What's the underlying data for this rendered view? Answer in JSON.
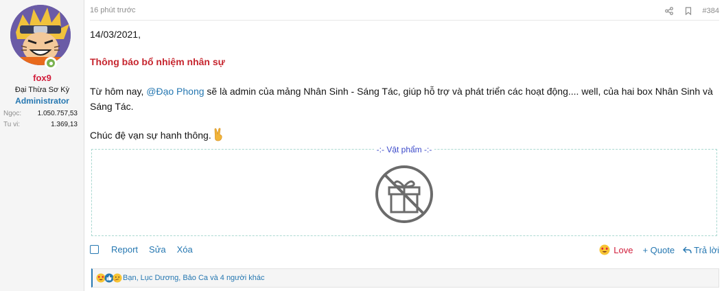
{
  "user": {
    "name": "fox9",
    "title": "Đại Thừa Sơ Kỳ",
    "role": "Administrator",
    "stats": [
      {
        "label": "Ngọc:",
        "value": "1.050.757,53"
      },
      {
        "label": "Tu vi:",
        "value": "1.369,13"
      }
    ]
  },
  "post": {
    "time": "16 phút trước",
    "number": "#384",
    "date": "14/03/2021,",
    "notice": "Thông báo bổ nhiệm nhân sự",
    "body_prefix": "Từ hôm nay, ",
    "mention": "@Đạo Phong",
    "body_rest": " sẽ là admin của mảng Nhân Sinh - Sáng Tác, giúp hỗ trợ và phát triển các hoạt động.... well, của hai box Nhân Sinh và",
    "body_line2": "Sáng Tác.",
    "closing": "Chúc đệ vạn sự hanh thông."
  },
  "items": {
    "legend": "-:- Vật phẩm -:-"
  },
  "actions": {
    "report": "Report",
    "edit": "Sửa",
    "delete": "Xóa",
    "love": "Love",
    "quote": "+ Quote",
    "reply": "Trả lời"
  },
  "reactions": {
    "text": "Bạn, Lục Dương, Bảo Ca và 4 người khác"
  },
  "colors": {
    "accent": "#2577b1",
    "username": "#d11c3a",
    "notice": "#c6252e",
    "items_legend": "#3a48c9"
  }
}
